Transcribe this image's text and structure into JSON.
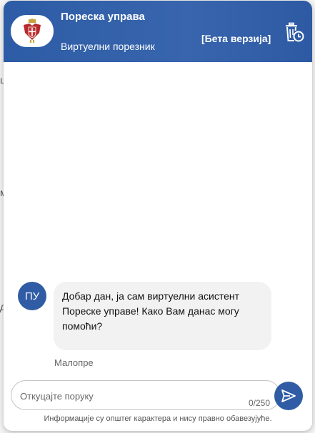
{
  "header": {
    "title": "Пореска управа",
    "subtitle": "Виртуелни порезник",
    "beta_label": "[Бета верзија]",
    "logo_icon": "serbia-coat-of-arms-icon",
    "clear_icon": "trash-clock-icon"
  },
  "messages": [
    {
      "avatar": "ПУ",
      "text": "Добар дан, ја сам виртуелни асистент Пореске управе! Како Вам данас могу помоћи?",
      "time": "Малопре"
    }
  ],
  "composer": {
    "placeholder": "Откуцајте поруку",
    "value": "",
    "counter": "0/250",
    "send_icon": "send-icon"
  },
  "footer": {
    "disclaimer": "Информације су општег карактера и нису правно обавезујуће."
  },
  "colors": {
    "brand": "#2f5ca5",
    "bubble": "#f2f2f2",
    "header_text": "#ffffff"
  }
}
